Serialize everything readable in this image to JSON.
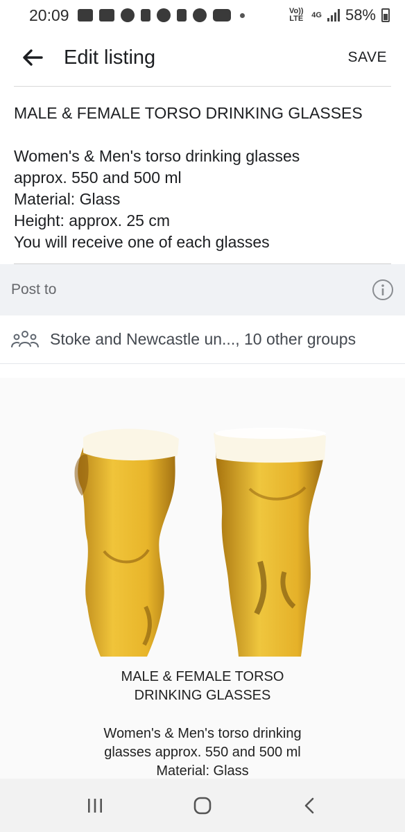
{
  "status_bar": {
    "time": "20:09",
    "network": "4G",
    "lte_label": "Vo)) LTE",
    "battery": "58%"
  },
  "app_bar": {
    "title": "Edit listing",
    "save_label": "SAVE",
    "back_icon": "back-arrow-icon"
  },
  "listing": {
    "title": "MALE & FEMALE TORSO DRINKING GLASSES",
    "description_lines": [
      "Women's & Men's torso drinking glasses",
      "approx. 550 and 500 ml",
      "Material: Glass",
      "Height: approx. 25 cm",
      "You will receive one of each glasses"
    ]
  },
  "post_to": {
    "label": "Post to",
    "info_icon": "info-icon",
    "groups_text": "Stoke and Newcastle un..., 10 other groups",
    "groups_icon": "groups-icon"
  },
  "photo": {
    "caption_title_lines": [
      "MALE & FEMALE TORSO",
      "DRINKING GLASSES"
    ],
    "caption_body_lines": [
      "Women's & Men's torso drinking",
      "glasses approx. 550 and 500 ml",
      "Material: Glass"
    ]
  },
  "colors": {
    "beer": "#e9b02a",
    "foam": "#fbf6e6",
    "post_to_bg": "#f0f2f5"
  }
}
